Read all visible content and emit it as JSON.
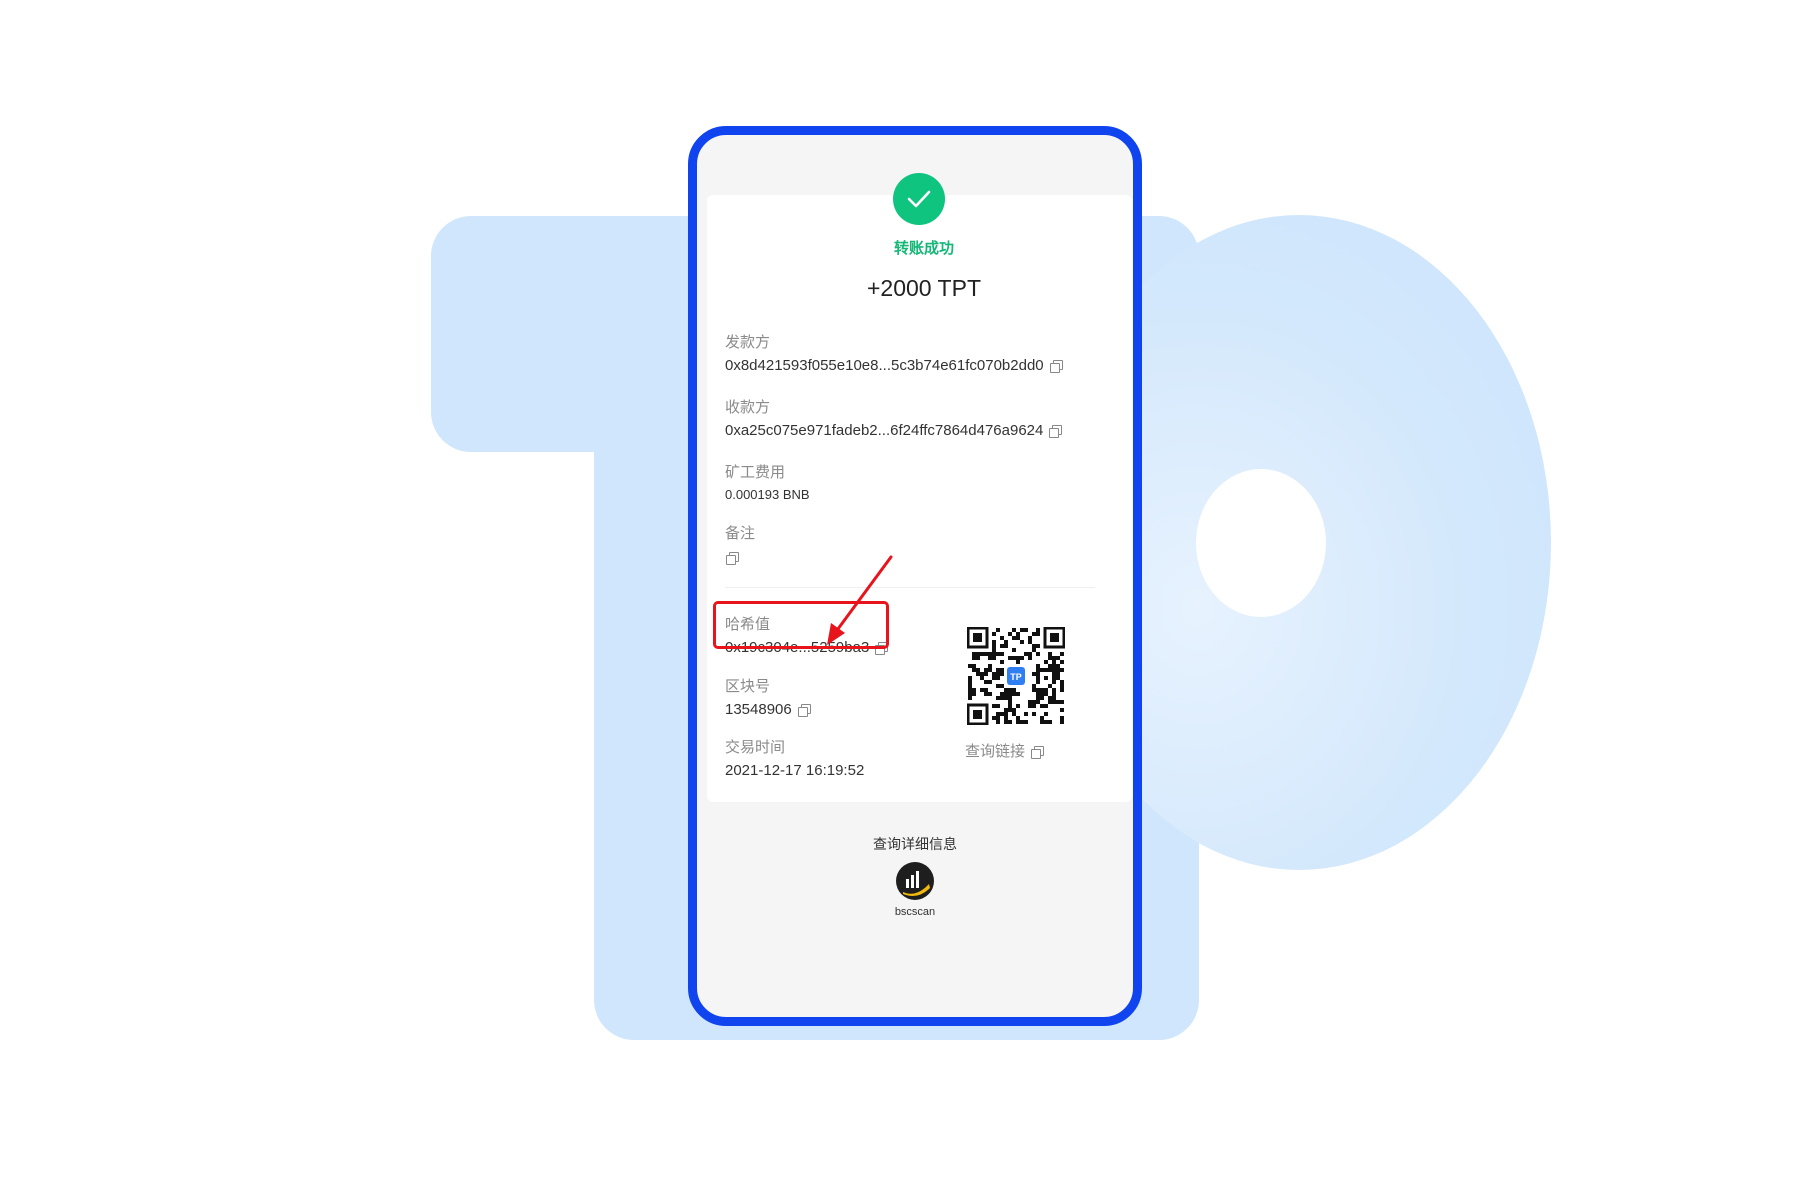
{
  "status": {
    "text": "转账成功"
  },
  "amount": "+2000 TPT",
  "fields": {
    "sender": {
      "label": "发款方",
      "value": "0x8d421593f055e10e8...5c3b74e61fc070b2dd0"
    },
    "receiver": {
      "label": "收款方",
      "value": "0xa25c075e971fadeb2...6f24ffc7864d476a9624"
    },
    "fee": {
      "label": "矿工费用",
      "value": "0.000193 BNB"
    },
    "memo": {
      "label": "备注",
      "value": ""
    },
    "hash": {
      "label": "哈希值",
      "value": "0x19c304e...5259ba3"
    },
    "block": {
      "label": "区块号",
      "value": "13548906"
    },
    "time": {
      "label": "交易时间",
      "value": "2021-12-17 16:19:52"
    }
  },
  "qr": {
    "link_label": "查询链接",
    "badge": "TP"
  },
  "details": {
    "title": "查询详细信息",
    "explorer": "bscscan"
  },
  "colors": {
    "phone_border": "#1044ee",
    "success": "#0fc47f",
    "highlight": "#e8141c",
    "logo_bg": "#cfe6fc"
  },
  "icons": [
    "check-icon",
    "copy-icon",
    "qr-code",
    "bscscan-logo",
    "annotation-arrow"
  ]
}
